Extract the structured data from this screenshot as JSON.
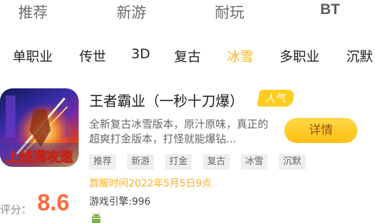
{
  "top_tabs": [
    "推荐",
    "新游",
    "耐玩",
    "BT"
  ],
  "categories": [
    "单职业",
    "传世",
    "3D",
    "复古",
    "冰雪",
    "多职业",
    "沉默"
  ],
  "active_category": "冰雪",
  "game": {
    "icon_text": "上线满攻速",
    "title": "王者霸业（一秒十刀爆）",
    "badge": "人气",
    "description": "全新复古冰雪版本，原汁原味，真正的超爽打金版本，打怪就能爆钻...",
    "detail_button": "详情",
    "tags": [
      "推荐",
      "新游",
      "打金",
      "复古",
      "冰雪",
      "沉默"
    ],
    "server_time": "首服时间2022年5月5日9点",
    "engine": "游戏引擎:996",
    "score_label": "评分：",
    "score": "8.6",
    "platform_icon": "android-icon"
  },
  "colors": {
    "accent": "#ffb21a",
    "score": "#ff6a3d",
    "button": "#ffc61c",
    "platform": "#7cb342"
  }
}
